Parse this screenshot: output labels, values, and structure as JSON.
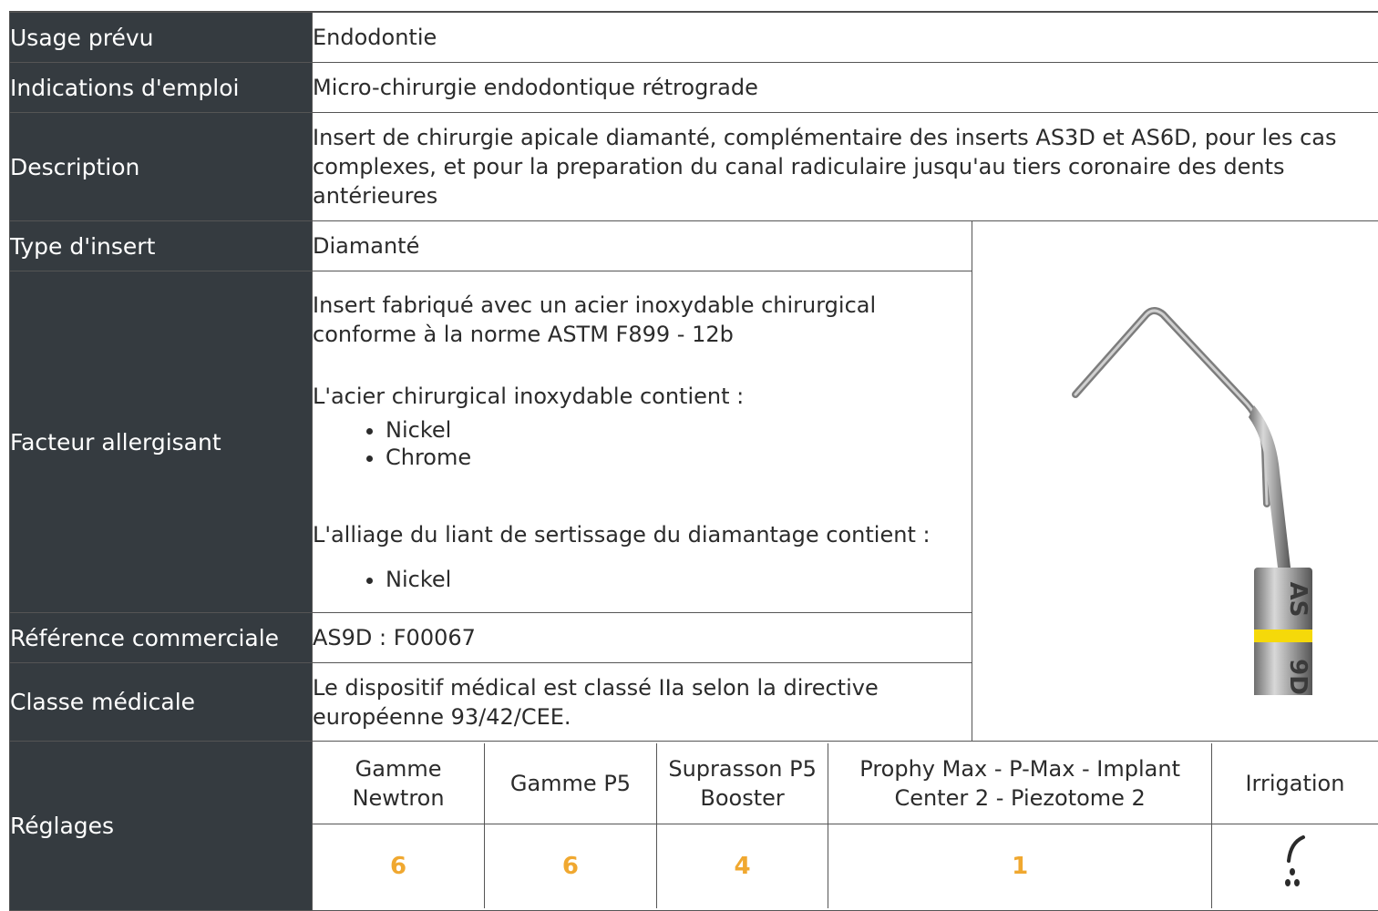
{
  "rows": {
    "usage": {
      "label": "Usage prévu",
      "value": "Endodontie"
    },
    "indications": {
      "label": "Indications d'emploi",
      "value": "Micro-chirurgie endodontique rétrograde"
    },
    "description": {
      "label": "Description",
      "value": "Insert de chirurgie apicale diamanté, complémentaire des inserts AS3D et AS6D, pour les cas complexes, et pour la preparation du canal radiculaire jusqu'au tiers coronaire des dents antérieures"
    },
    "type": {
      "label": "Type d'insert",
      "value": "Diamanté"
    },
    "allergen": {
      "label": "Facteur allergisant",
      "intro": "Insert fabriqué avec un acier inoxydable chirurgical conforme à la norme ASTM F899 - 12b",
      "steel_heading": "L'acier chirurgical inoxydable contient :",
      "steel_items": [
        "Nickel",
        "Chrome"
      ],
      "alloy_heading": "L'alliage du liant de sertissage du diamantage contient :",
      "alloy_items": [
        "Nickel"
      ]
    },
    "reference": {
      "label": "Référence commerciale",
      "value": "AS9D : F00067"
    },
    "class": {
      "label": "Classe médicale",
      "value": "Le dispositif médical est classé IIa selon la directive européenne 93/42/CEE."
    }
  },
  "product_image": {
    "icon": "ultrasonic-insert-image",
    "engraving_top": "AS",
    "engraving_bottom": "9D",
    "ring_color": "#f5d90a"
  },
  "settings": {
    "label": "Réglages",
    "headers": [
      "Gamme Newtron",
      "Gamme P5",
      "Suprasson P5 Booster",
      "Prophy Max - P-Max - Implant Center 2 - Piezotome 2",
      "Irrigation"
    ],
    "values": [
      "6",
      "6",
      "4",
      "1"
    ],
    "irrigation_icon": "irrigation-drops-icon",
    "value_color": "#f0a830"
  }
}
